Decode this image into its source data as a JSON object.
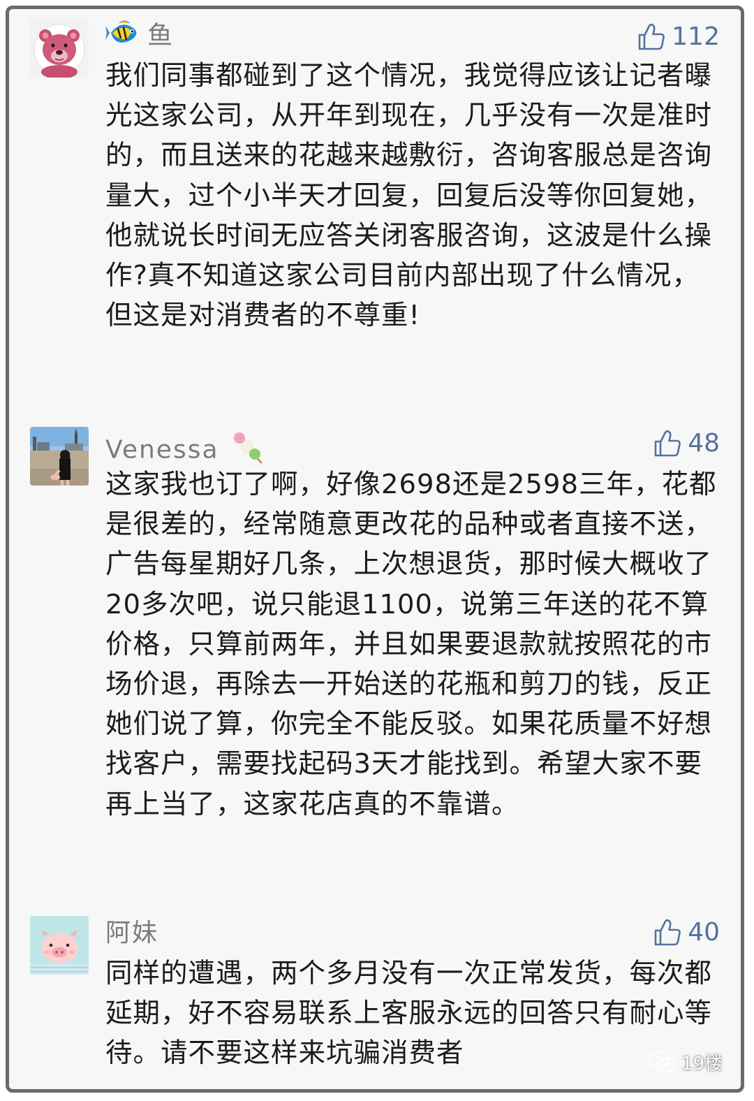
{
  "comments": [
    {
      "username": "鱼",
      "likes": "112",
      "text": "我们同事都碰到了这个情况，我觉得应该让记者曝光这家公司，从开年到现在，几乎没有一次是准时的，而且送来的花越来越敷衍，咨询客服总是咨询量大，过个小半天才回复，回复后没等你回复她，他就说长时间无应答关闭客服咨询，这波是什么操作?真不知道这家公司目前内部出现了什么情况，但这是对消费者的不尊重!"
    },
    {
      "username": "Venessa",
      "likes": "48",
      "text": "这家我也订了啊，好像2698还是2598三年，花都是很差的，经常随意更改花的品种或者直接不送，广告每星期好几条，上次想退货，那时候大概收了20多次吧，说只能退1100，说第三年送的花不算价格，只算前两年，并且如果要退款就按照花的市场价退，再除去一开始送的花瓶和剪刀的钱，反正她们说了算，你完全不能反驳。如果花质量不好想找客户，需要找起码3天才能找到。希望大家不要再上当了，这家花店真的不靠谱。"
    },
    {
      "username": "阿妹",
      "likes": "40",
      "text": "同样的遭遇，两个多月没有一次正常发货，每次都延期，好不容易联系上客服永远的回答只有耐心等待。请不要这样来坑骗消费者"
    }
  ],
  "watermark": {
    "label": "19楼"
  },
  "colors": {
    "likes": "#54709e",
    "username": "#7b7b7b",
    "text": "#1b1b1b",
    "background": "#f7f7f7",
    "border": "#6a6a6a"
  },
  "icons": {
    "like": "thumbs-up-outline-icon",
    "fish_badge": "fish-emoji-icon",
    "dango_badge": "dango-emoji-icon",
    "watermark_logo": "wechat-icon"
  }
}
